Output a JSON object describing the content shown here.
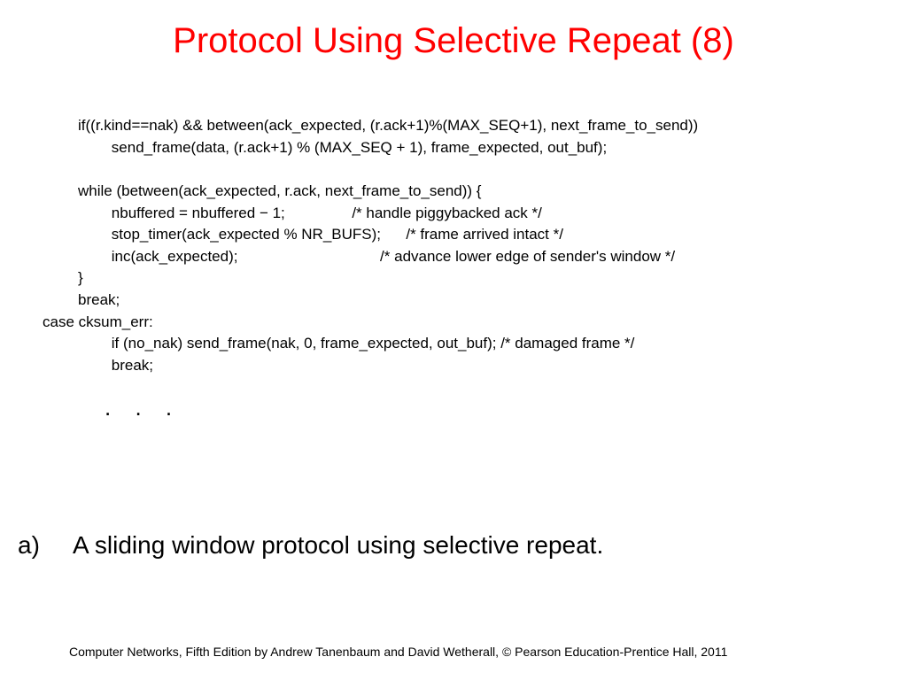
{
  "title": "Protocol Using Selective Repeat (8)",
  "code": {
    "l1": "if((r.kind==nak) && between(ack_expected, (r.ack+1)%(MAX_SEQ+1), next_frame_to_send))",
    "l2": "        send_frame(data, (r.ack+1) % (MAX_SEQ + 1), frame_expected, out_buf);",
    "l3": "",
    "l4": "while (between(ack_expected, r.ack, next_frame_to_send)) {",
    "l5": "        nbuffered = nbuffered − 1;                /* handle piggybacked ack */",
    "l6": "        stop_timer(ack_expected % NR_BUFS);      /* frame arrived intact */",
    "l7": "        inc(ack_expected);                                  /* advance lower edge of sender's window */",
    "l8": "}",
    "l9": "break;",
    "l10": "case cksum_err:",
    "l11": "        if (no_nak) send_frame(nak, 0, frame_expected, out_buf); /* damaged frame */",
    "l12": "        break;"
  },
  "ellipsis": ". . .",
  "caption": {
    "label": "a)",
    "text": "A sliding window protocol using selective repeat."
  },
  "footer": "Computer Networks, Fifth Edition by Andrew Tanenbaum and David Wetherall, © Pearson Education-Prentice Hall, 2011"
}
